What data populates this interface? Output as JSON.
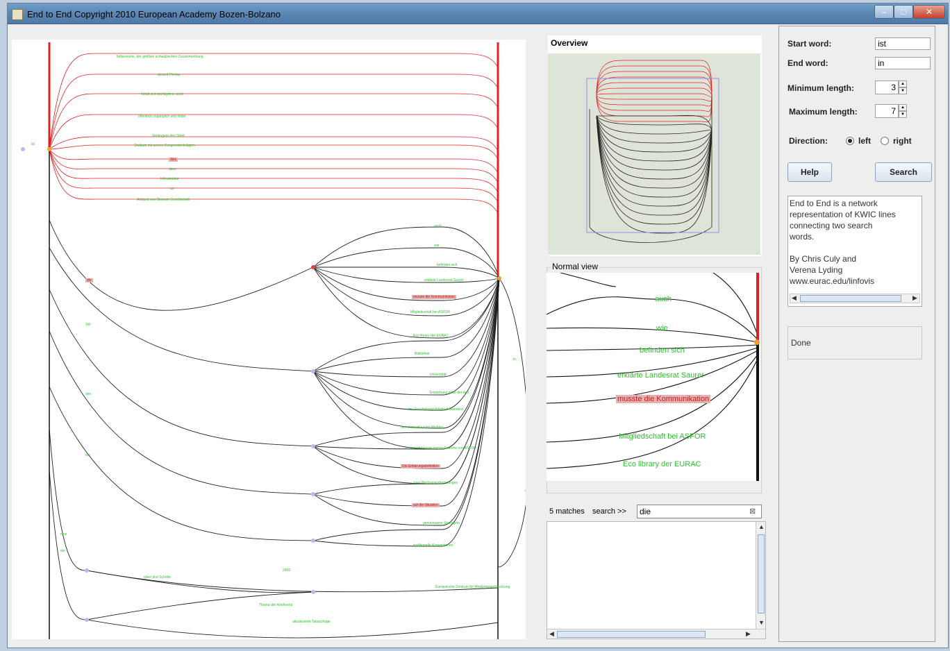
{
  "window": {
    "title": "End to End Copyright 2010 European Academy Bozen-Bolzano"
  },
  "controls": {
    "start_word_label": "Start word:",
    "start_word": "ist",
    "end_word_label": "End word:",
    "end_word": "in",
    "min_length_label": "Minimum length:",
    "min_length": "3",
    "max_length_label": "Maximum length:",
    "max_length": "7",
    "direction_label": "Direction:",
    "dir_left": "left",
    "dir_right": "right",
    "direction_selected": "left",
    "help_label": "Help",
    "search_label": "Search"
  },
  "info_text": "End to End is a network\nrepresentation of KWIC lines\nconnecting two search\nwords.\n\nBy Chris Culy and\nVerena Lyding\nwww.eurac.edu/linfovis",
  "status_text": "Done",
  "overview": {
    "label": "Overview"
  },
  "normal_view": {
    "label": "Normal view",
    "labels": [
      {
        "text": "auch",
        "hl": false
      },
      {
        "text": "wie",
        "hl": false
      },
      {
        "text": "befinden sich",
        "hl": false
      },
      {
        "text": "erklärte Landesrat Saurer",
        "hl": false
      },
      {
        "text": "musste die Kommunikation",
        "hl": true
      },
      {
        "text": "Mitgliedschaft bei ASFOR",
        "hl": false
      },
      {
        "text": "Eco library der EURAC",
        "hl": false
      }
    ]
  },
  "search": {
    "matches": "5 matches",
    "label": "search >>",
    "value": "die"
  },
  "graph": {
    "start_node_label": "ist",
    "end_node_label": "in",
    "top_labels": [
      {
        "text": "Teilbereiche, der größten schwäbischen Zusammenhang",
        "hl": false
      },
      {
        "text": "derzeit Thema",
        "hl": false
      },
      {
        "text": "Inhalt seit wichtigsten, auch",
        "hl": false
      },
      {
        "text": "öffentlich zugänglich und findet",
        "hl": false
      },
      {
        "text": "Verlängern des Streit",
        "hl": false
      },
      {
        "text": "Studium mit seinen Kongressbeteiligten",
        "hl": false
      },
      {
        "text": "dies",
        "hl": true
      },
      {
        "text": "dann",
        "hl": false
      },
      {
        "text": "Infrastruktur",
        "hl": false
      },
      {
        "text": "an",
        "hl": false
      },
      {
        "text": "Anhand von Ökonom Gesellschaft",
        "hl": false
      }
    ],
    "mid_labels": [
      {
        "text": "auch",
        "hl": false
      },
      {
        "text": "wie",
        "hl": false
      },
      {
        "text": "befinden sich",
        "hl": false
      },
      {
        "text": "erklärte Landesrat Saurer",
        "hl": false
      },
      {
        "text": "musste die Kommunikation",
        "hl": true
      },
      {
        "text": "Mitgliedschaft bei ASFOR",
        "hl": false
      },
      {
        "text": "Eco library der EURAC",
        "hl": false
      },
      {
        "text": "Bibliothek",
        "hl": false
      },
      {
        "text": "Universität",
        "hl": false
      },
      {
        "text": "Entstehung einer der drei",
        "hl": false
      },
      {
        "text": "der Verarbeitungsfähigkeit Standard",
        "hl": false
      },
      {
        "text": "des internationalen Marktes",
        "hl": false
      },
      {
        "text": "einer Verbesserungsmaßnahme von ASFOR",
        "hl": false
      },
      {
        "text": "Die Erklärungsdefinition",
        "hl": true
      },
      {
        "text": "zwei Wachstumsforderungen",
        "hl": false
      },
      {
        "text": "auf die Situation",
        "hl": true
      },
      {
        "text": "gemeinsame Strategien",
        "hl": false
      },
      {
        "text": "traditionelle Konventionen",
        "hl": false
      },
      {
        "text": "2005",
        "hl": false
      },
      {
        "text": "Europäische Zentrum für Minderheitenforschung",
        "hl": false
      },
      {
        "text": "Thema der Konferenz",
        "hl": false
      },
      {
        "text": "aktualisierte Tatsachlage",
        "hl": false
      },
      {
        "text": "eben drei Schritte",
        "hl": false
      }
    ],
    "left_labels": [
      {
        "text": "die",
        "hl": true
      },
      {
        "text": "Teil",
        "hl": false
      },
      {
        "text": "den",
        "hl": false
      },
      {
        "text": "ein",
        "hl": false
      },
      {
        "text": "eine",
        "hl": false
      },
      {
        "text": "der",
        "hl": false
      }
    ]
  }
}
